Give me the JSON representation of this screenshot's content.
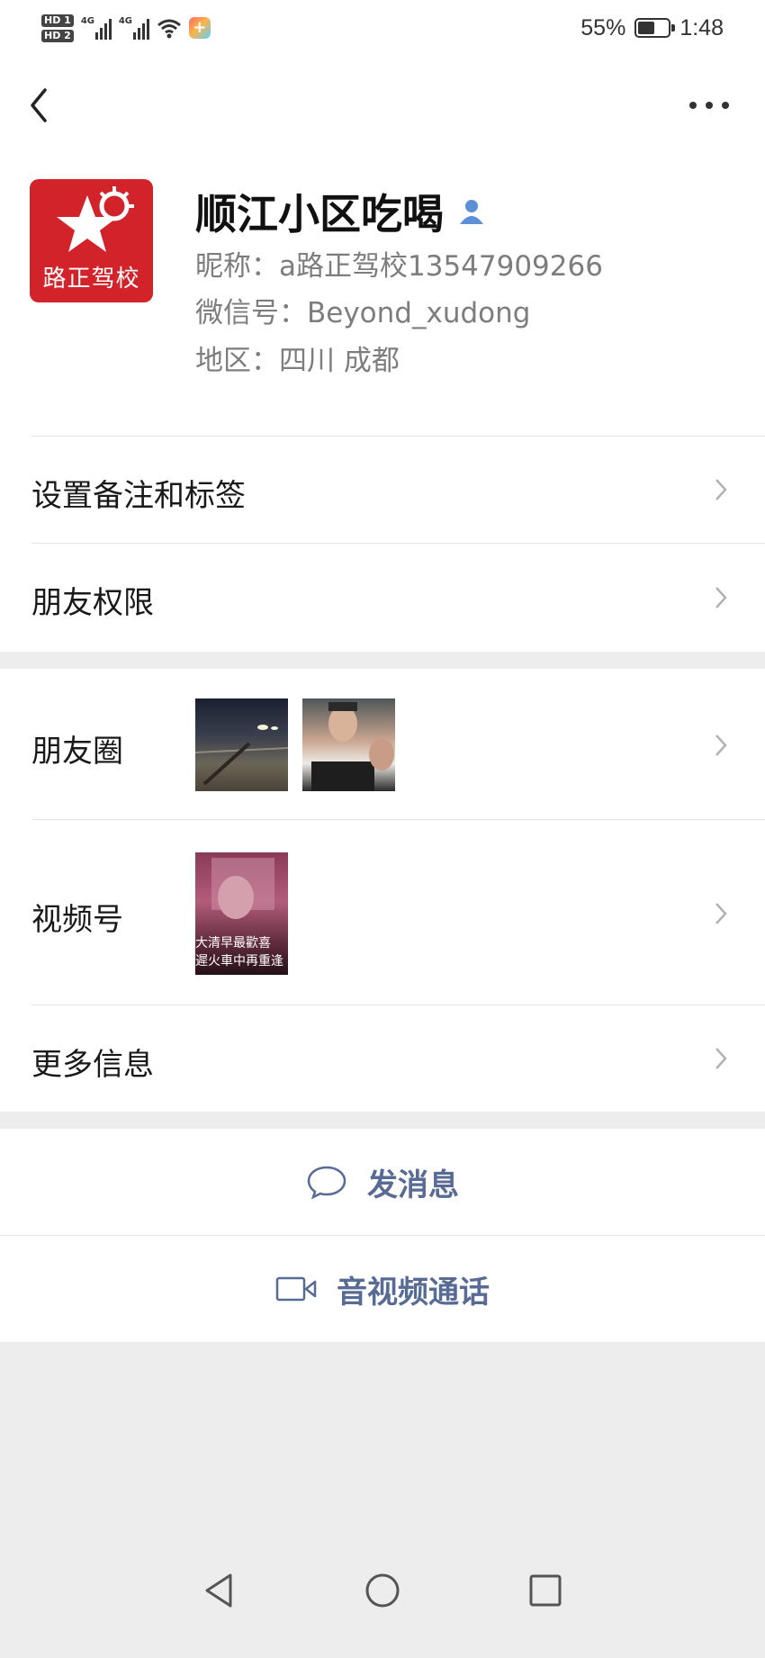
{
  "status_bar": {
    "sim1": "HD 1",
    "sim2": "HD 2",
    "network1": "4G",
    "network2": "4G",
    "battery_percent": "55%",
    "time": "1:48",
    "icons": [
      "signal-icon",
      "wifi-icon",
      "app-notification-icon",
      "battery-icon"
    ]
  },
  "header": {
    "back_icon": "chevron-left-icon",
    "more_icon": "more-dots-icon"
  },
  "profile": {
    "avatar_text": "路正驾校",
    "name": "顺江小区吃喝",
    "contact_icon": "person-icon",
    "nickname": "昵称：a路正驾校13547909266",
    "wechat_id": "微信号：Beyond_xudong",
    "region": "地区：四川  成都"
  },
  "rows": {
    "remark": "设置备注和标签",
    "permissions": "朋友权限",
    "moments": "朋友圈",
    "channels": "视频号",
    "more_info": "更多信息"
  },
  "channels_caption": {
    "line1": "大清早最歡喜",
    "line2": "遲火車中再重逢"
  },
  "actions": {
    "message": "发消息",
    "call": "音视频通话"
  },
  "colors": {
    "accent_link": "#576b95",
    "avatar_red": "#d2232a",
    "contact_icon_blue": "#5b8fd6"
  }
}
